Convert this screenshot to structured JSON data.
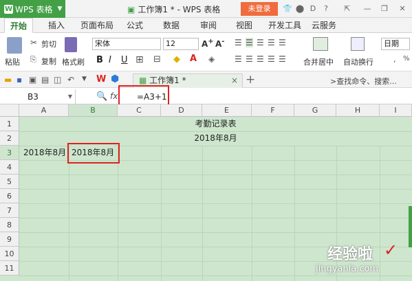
{
  "app": {
    "name": "WPS 表格",
    "doc_title": "工作簿1 * - WPS 表格",
    "login": "未登录"
  },
  "tabs": [
    "开始",
    "插入",
    "页面布局",
    "公式",
    "数据",
    "审阅",
    "视图",
    "开发工具",
    "云服务"
  ],
  "ribbon": {
    "paste": "粘贴",
    "cut": "剪切",
    "copy": "复制",
    "format_painter": "格式刷",
    "font": "宋体",
    "size": "12",
    "merge": "合并居中",
    "wrap": "自动换行",
    "number_format": "日期"
  },
  "doctab": {
    "name": "工作簿1 *",
    "search": ">查找命令、搜索..."
  },
  "formula_bar": {
    "name_box": "B3",
    "fx": "fx",
    "formula": "=A3+1"
  },
  "columns": [
    "A",
    "B",
    "C",
    "D",
    "E",
    "F",
    "G",
    "H",
    "I"
  ],
  "rows": [
    "1",
    "2",
    "3",
    "4",
    "5",
    "6",
    "7",
    "8",
    "9",
    "10",
    "11"
  ],
  "cells": {
    "r1": "考勤记录表",
    "r2": "2018年8月",
    "a3": "2018年8月",
    "b3": "2018年8月"
  },
  "watermark": {
    "main": "经验啦",
    "sub": "jingyanla.com"
  },
  "colors": {
    "brand": "#43a047",
    "login": "#ef6c3e",
    "sheet_fill": "#cde6cd",
    "highlight": "#e02020"
  }
}
